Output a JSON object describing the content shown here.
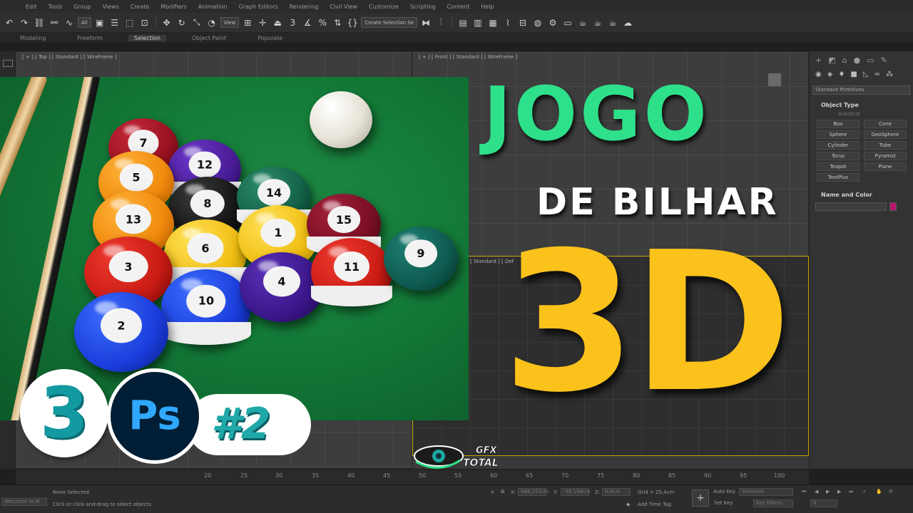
{
  "menubar": [
    "Edit",
    "Tools",
    "Group",
    "Views",
    "Create",
    "Modifiers",
    "Animation",
    "Graph Editors",
    "Rendering",
    "Civil View",
    "Customize",
    "Scripting",
    "Content",
    "Help"
  ],
  "toolbar": {
    "filter_value": "All",
    "view_value": "View",
    "selection_set_value": "Create Selection Se"
  },
  "ribbon": {
    "tabs": [
      "Modeling",
      "Freeform",
      "Selection",
      "Object Paint",
      "Populate"
    ],
    "active": "Selection"
  },
  "viewports": {
    "top_label": "[ + ] [ Top ] [ Standard ] [ Wireframe ]",
    "front_label": "[ + ] [ Front ] [ Standard ] [ Wireframe ]",
    "persp_label": "[ Standard ] [ Def"
  },
  "command_panel": {
    "dropdown": "Standard Primitives",
    "object_type_header": "Object Type",
    "autogrid": "AutoGrid",
    "primitives": [
      "Box",
      "Cone",
      "Sphere",
      "GeoSphere",
      "Cylinder",
      "Tube",
      "Torus",
      "Pyramid",
      "Teapot",
      "Plane",
      "TextPlus"
    ],
    "name_color_header": "Name and Color",
    "swatch_color": "#b5166b"
  },
  "ruler": {
    "ticks": [
      "20",
      "25",
      "30",
      "35",
      "40",
      "45",
      "50",
      "55",
      "60",
      "65",
      "70",
      "75",
      "80",
      "85",
      "90",
      "95",
      "100"
    ]
  },
  "status": {
    "script_box": "Welcome to M",
    "none_selected": "None Selected",
    "hint": "Click or click-and-drag to select objects",
    "x_label": "X:",
    "x_value": "488,152cm",
    "y_label": "Y:",
    "y_value": "-38,198cm",
    "z_label": "Z:",
    "z_value": "0,0cm",
    "grid": "Grid = 25,4cm",
    "add_time_tag": "Add Time Tag",
    "auto_key": "Auto Key",
    "set_key": "Set Key",
    "selected_dropdown": "Selected",
    "key_filters": "Key Filters...",
    "frame_value": "0"
  },
  "thumbnail": {
    "title_line1": "JOGO",
    "title_line2": "DE BILHAR",
    "title_line3": "3D",
    "episode_badge": "#2",
    "logo_3ds": "3",
    "logo_ps": "Ps",
    "channel_logo_line1": "GFX",
    "channel_logo_line2": "TOTAL",
    "colors": {
      "green": "#2ee08a",
      "yellow": "#fbc21b",
      "teal": "#1fa8a8",
      "felt": "#137a38"
    },
    "balls": [
      "7",
      "12",
      "5",
      "8",
      "14",
      "13",
      "6",
      "1",
      "15",
      "3",
      "10",
      "4",
      "11",
      "9",
      "2"
    ]
  }
}
